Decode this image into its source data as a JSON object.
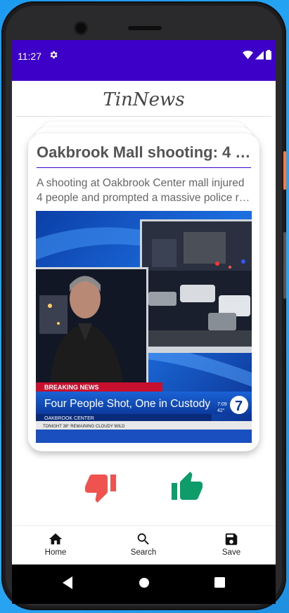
{
  "status_bar": {
    "time": "11:27",
    "settings_icon": "gear-icon",
    "wifi_icon": "wifi-icon",
    "signal_icon": "signal-icon",
    "battery_icon": "battery-icon"
  },
  "app": {
    "title": "TinNews"
  },
  "card": {
    "title": "Oakbrook Mall shooting: 4 s...",
    "description_line1": "A shooting at Oakbrook Center mall injured",
    "description_line2": "4 people and prompted a massive police re...",
    "image": {
      "breaking_label": "BREAKING NEWS",
      "headline": "Four People Shot, One in Custody",
      "location": "OAKBROOK CENTER",
      "ticker": "TONIGHT   38°  REMAINING CLOUDY WILD",
      "channel": "7",
      "time": "7:09",
      "temp": "42°"
    }
  },
  "actions": {
    "dislike_icon": "thumb-down-icon",
    "like_icon": "thumb-up-icon",
    "dislike_color": "#f0524f",
    "like_color": "#0e9c6a"
  },
  "bottom_nav": [
    {
      "label": "Home",
      "icon": "home-icon"
    },
    {
      "label": "Search",
      "icon": "search-icon"
    },
    {
      "label": "Save",
      "icon": "save-icon"
    }
  ],
  "colors": {
    "primary": "#3d00c8",
    "background": "#1e9bf0"
  }
}
